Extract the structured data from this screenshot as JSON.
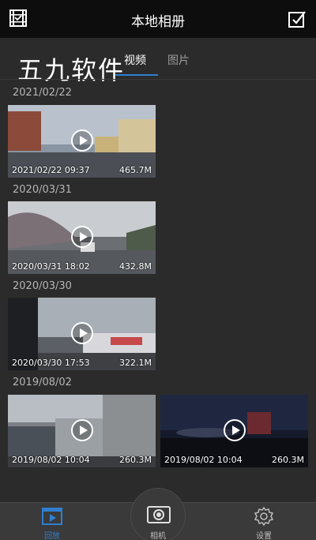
{
  "header": {
    "title": "本地相册",
    "left_icon": "album-icon",
    "right_icon": "select-checkbox-icon"
  },
  "watermark": "五九软件",
  "tabs": [
    {
      "label": "视频",
      "active": true
    },
    {
      "label": "图片",
      "active": false
    }
  ],
  "groups": [
    {
      "date": "2021/02/22",
      "items": [
        {
          "timestamp": "2021/02/22 09:37",
          "size": "465.7M"
        }
      ]
    },
    {
      "date": "2020/03/31",
      "items": [
        {
          "timestamp": "2020/03/31 18:02",
          "size": "432.8M"
        }
      ]
    },
    {
      "date": "2020/03/30",
      "items": [
        {
          "timestamp": "2020/03/30 17:53",
          "size": "322.1M"
        }
      ]
    },
    {
      "date": "2019/08/02",
      "items": [
        {
          "timestamp": "2019/08/02 10:04",
          "size": "260.3M"
        },
        {
          "timestamp": "2019/08/02 10:04",
          "size": "260.3M"
        }
      ]
    }
  ],
  "bottom_nav": {
    "playback": {
      "label": "回放",
      "icon": "playback-icon",
      "active": true
    },
    "camera": {
      "label": "相机",
      "icon": "camera-icon"
    },
    "settings": {
      "label": "设置",
      "icon": "gear-icon"
    }
  },
  "colors": {
    "accent": "#2f7fd0",
    "header_bg": "#0d0d0d",
    "page_bg": "#2b2b2b"
  }
}
